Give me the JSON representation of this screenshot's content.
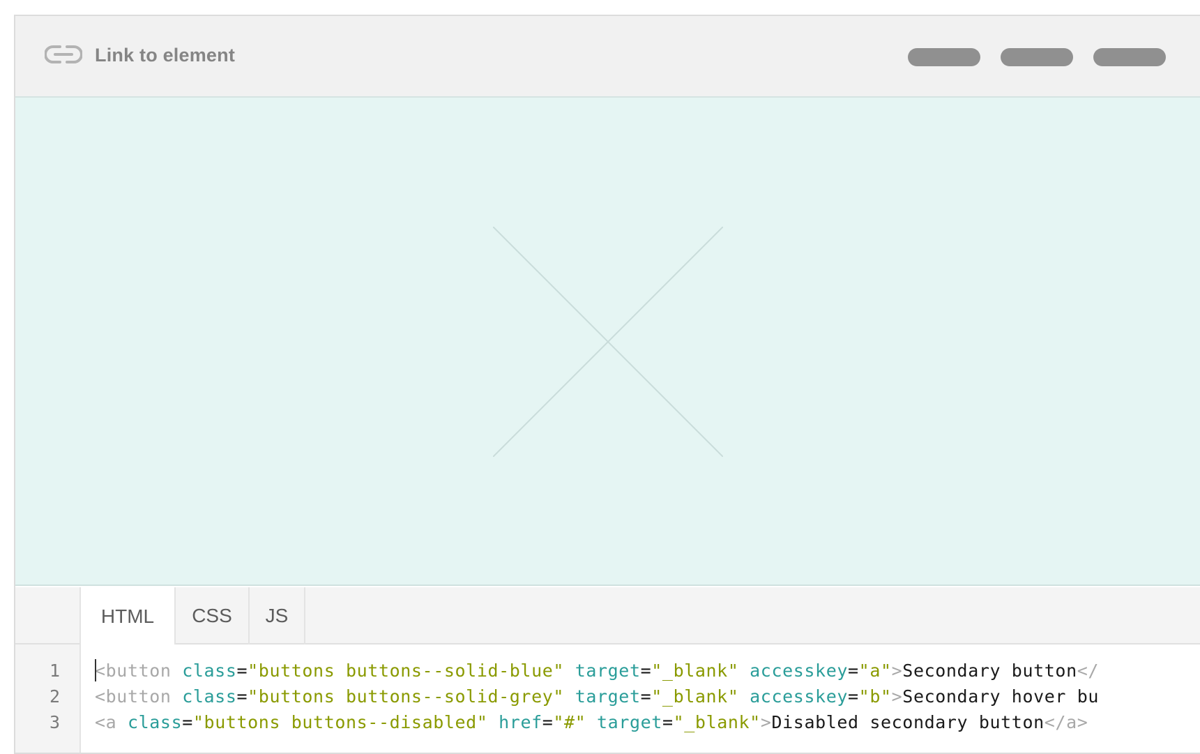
{
  "header": {
    "link_label": "Link to element",
    "icons": {
      "link": "link-icon"
    },
    "pill_color": "#909090"
  },
  "preview": {
    "background": "#e5f5f3",
    "placeholder": "image-placeholder-x"
  },
  "tabs": [
    {
      "label": "HTML",
      "active": true
    },
    {
      "label": "CSS",
      "active": false
    },
    {
      "label": "JS",
      "active": false
    }
  ],
  "code": {
    "line_numbers": [
      "1",
      "2",
      "3"
    ],
    "lines": [
      [
        {
          "t": "tag",
          "s": "<button"
        },
        {
          "t": "text",
          "s": " "
        },
        {
          "t": "attr",
          "s": "class"
        },
        {
          "t": "eq",
          "s": "="
        },
        {
          "t": "val",
          "s": "\"buttons buttons--solid-blue\""
        },
        {
          "t": "text",
          "s": " "
        },
        {
          "t": "attr",
          "s": "target"
        },
        {
          "t": "eq",
          "s": "="
        },
        {
          "t": "val",
          "s": "\"_blank\""
        },
        {
          "t": "text",
          "s": " "
        },
        {
          "t": "attr",
          "s": "accesskey"
        },
        {
          "t": "eq",
          "s": "="
        },
        {
          "t": "val",
          "s": "\"a\""
        },
        {
          "t": "tag",
          "s": ">"
        },
        {
          "t": "text",
          "s": "Secondary button"
        },
        {
          "t": "tag",
          "s": "</"
        }
      ],
      [
        {
          "t": "tag",
          "s": "<button"
        },
        {
          "t": "text",
          "s": " "
        },
        {
          "t": "attr",
          "s": "class"
        },
        {
          "t": "eq",
          "s": "="
        },
        {
          "t": "val",
          "s": "\"buttons buttons--solid-grey\""
        },
        {
          "t": "text",
          "s": " "
        },
        {
          "t": "attr",
          "s": "target"
        },
        {
          "t": "eq",
          "s": "="
        },
        {
          "t": "val",
          "s": "\"_blank\""
        },
        {
          "t": "text",
          "s": " "
        },
        {
          "t": "attr",
          "s": "accesskey"
        },
        {
          "t": "eq",
          "s": "="
        },
        {
          "t": "val",
          "s": "\"b\""
        },
        {
          "t": "tag",
          "s": ">"
        },
        {
          "t": "text",
          "s": "Secondary hover bu"
        }
      ],
      [
        {
          "t": "tag",
          "s": "<a"
        },
        {
          "t": "text",
          "s": " "
        },
        {
          "t": "attr",
          "s": "class"
        },
        {
          "t": "eq",
          "s": "="
        },
        {
          "t": "val",
          "s": "\"buttons buttons--disabled\""
        },
        {
          "t": "text",
          "s": " "
        },
        {
          "t": "attr",
          "s": "href"
        },
        {
          "t": "eq",
          "s": "="
        },
        {
          "t": "val",
          "s": "\"#\""
        },
        {
          "t": "text",
          "s": " "
        },
        {
          "t": "attr",
          "s": "target"
        },
        {
          "t": "eq",
          "s": "="
        },
        {
          "t": "val",
          "s": "\"_blank\""
        },
        {
          "t": "tag",
          "s": ">"
        },
        {
          "t": "text",
          "s": "Disabled secondary button"
        },
        {
          "t": "tag",
          "s": "</a>"
        }
      ]
    ]
  }
}
